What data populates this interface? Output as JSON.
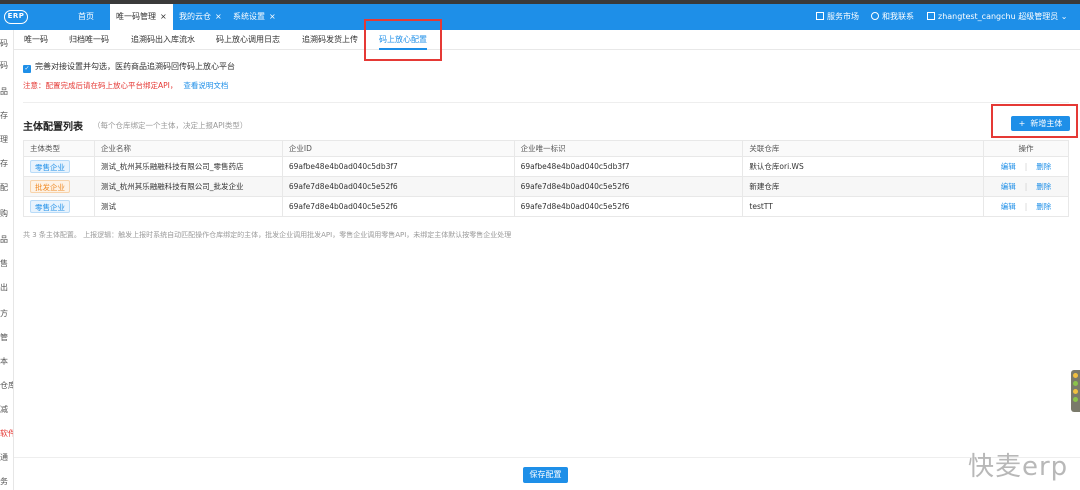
{
  "header": {
    "logo_text": "ERP",
    "tabs": [
      {
        "label": "首页",
        "closable": false,
        "active": false
      },
      {
        "label": "唯一码管理",
        "closable": true,
        "active": true
      },
      {
        "label": "我的云仓",
        "closable": true,
        "active": false
      },
      {
        "label": "系统设置",
        "closable": true,
        "active": false
      }
    ],
    "close_glyph": "×",
    "service_market": "服务市场",
    "contact": "和我联系",
    "username": "zhangtest_cangchu",
    "role": "超级管理员",
    "role_caret": "⌄"
  },
  "left_nav": {
    "items": [
      "码",
      "码",
      "品",
      "存",
      "理",
      "存",
      "配",
      "购",
      "品",
      "售",
      "出",
      "方",
      "管",
      "本",
      "仓库",
      "减",
      "软件",
      "通",
      "务"
    ]
  },
  "sub_tabs": [
    {
      "label": "唯一码",
      "active": false
    },
    {
      "label": "归档唯一码",
      "active": false
    },
    {
      "label": "追溯码出入库流水",
      "active": false
    },
    {
      "label": "码上放心调用日志",
      "active": false
    },
    {
      "label": "追溯码发货上传",
      "active": false
    },
    {
      "label": "码上放心配置",
      "active": true
    }
  ],
  "settings": {
    "checkbox_checked": true,
    "checkbox_label": "完善对接设置并勾选，医药商品追溯码回传码上放心平台",
    "note": "注意：配置完成后请在码上放心平台绑定API，",
    "doc_link": "查看说明文档"
  },
  "section": {
    "title": "主体配置列表",
    "hint": "（每个仓库绑定一个主体，决定上报API类型）",
    "add_button": "新增主体",
    "add_icon": "+"
  },
  "table": {
    "columns": [
      "主体类型",
      "企业名称",
      "企业ID",
      "企业唯一标识",
      "关联仓库",
      "操作"
    ],
    "rows": [
      {
        "type": "零售企业",
        "type_kind": "retail",
        "name": "测试_杭州其乐融融科技有限公司_零售药店",
        "id": "69afbe48e4b0ad040c5db3f7",
        "uid": "69afbe48e4b0ad040c5db3f7",
        "warehouse": "默认仓库ori.WS"
      },
      {
        "type": "批发企业",
        "type_kind": "whole",
        "name": "测试_杭州其乐融融科技有限公司_批发企业",
        "id": "69afe7d8e4b0ad040c5e52f6",
        "uid": "69afe7d8e4b0ad040c5e52f6",
        "warehouse": "新建仓库"
      },
      {
        "type": "零售企业",
        "type_kind": "retail",
        "name": "测试",
        "id": "69afe7d8e4b0ad040c5e52f6",
        "uid": "69afe7d8e4b0ad040c5e52f6",
        "warehouse": "testTT"
      }
    ],
    "edit_label": "编辑",
    "delete_label": "删除",
    "op_sep": "|"
  },
  "footnote": "共 3 条主体配置。 上报逻辑：触发上报时系统自动匹配操作仓库绑定的主体，批发企业调用批发API，零售企业调用零售API，未绑定主体默认按零售企业处理",
  "save_button": "保存配置",
  "watermark": "快麦erp",
  "colors": {
    "primary": "#1e8fe8",
    "danger": "#e53935",
    "wholesale": "#f08a24"
  }
}
